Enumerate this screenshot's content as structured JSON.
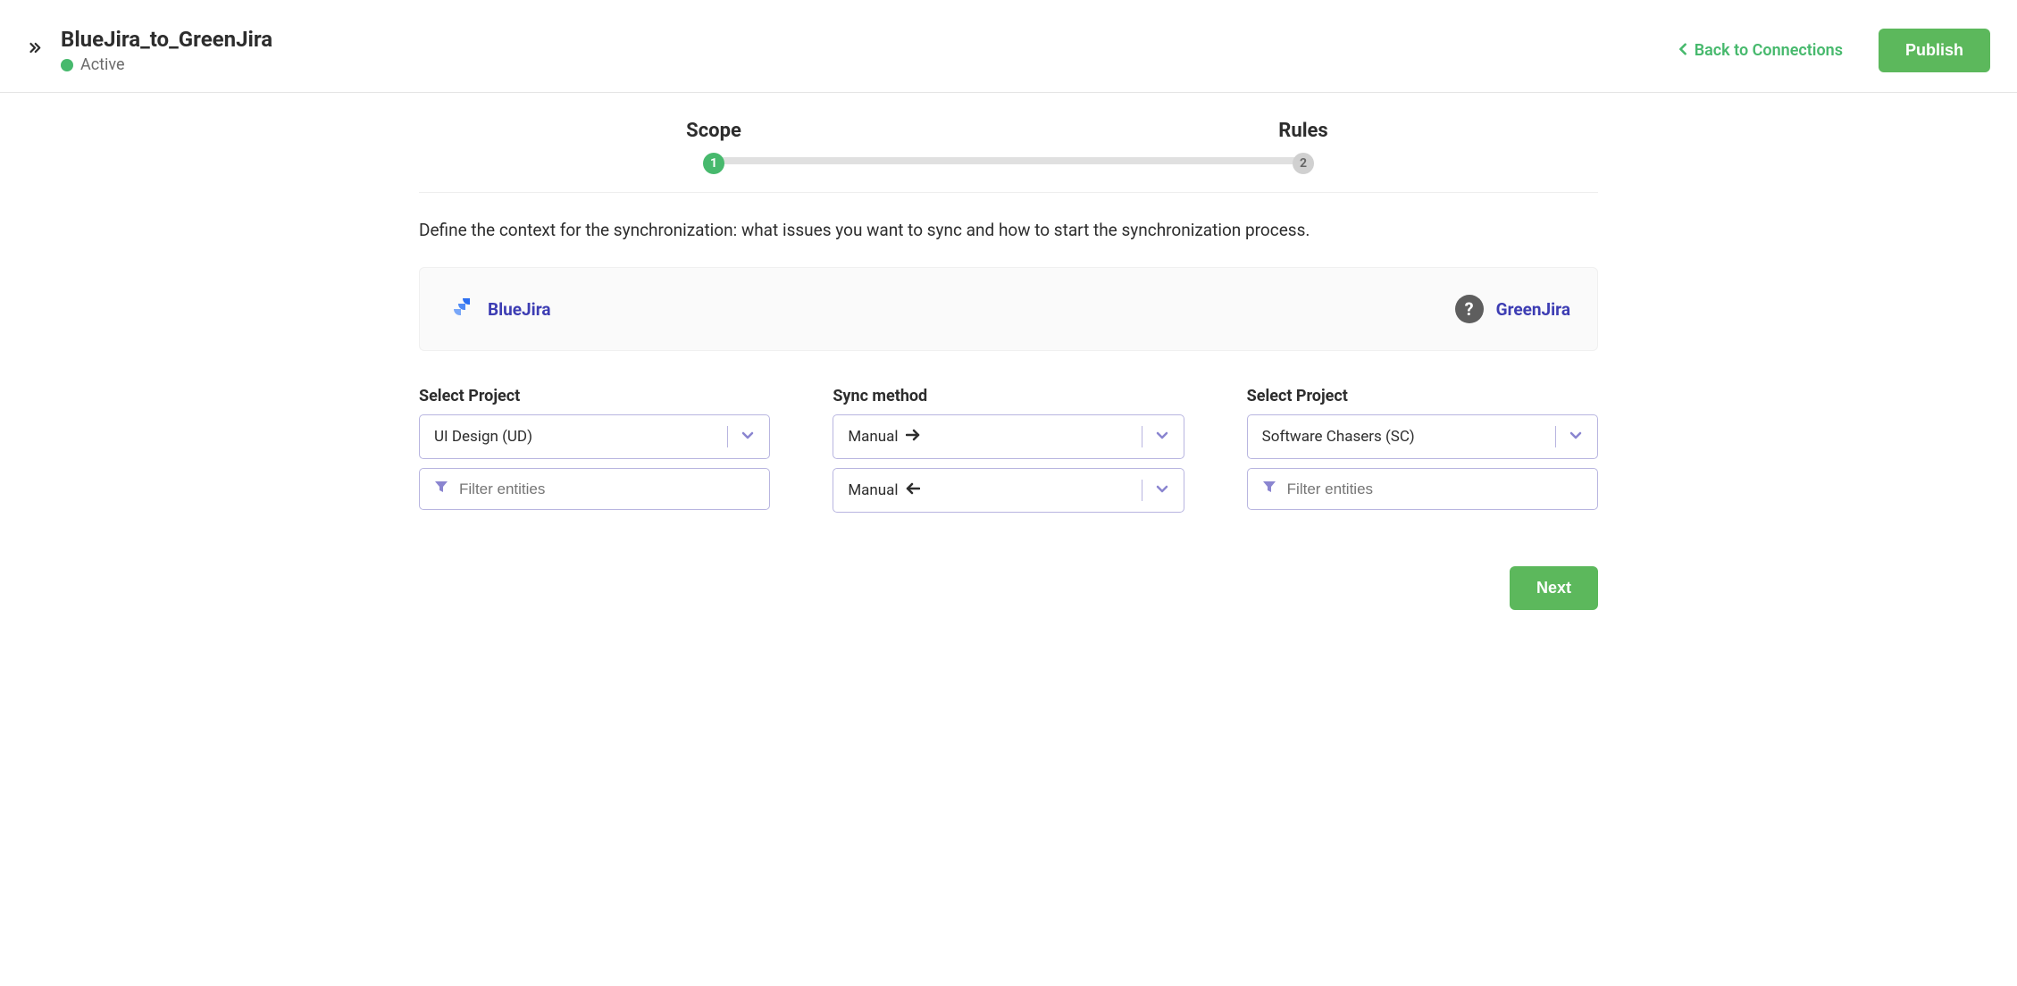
{
  "header": {
    "title": "BlueJira_to_GreenJira",
    "status": "Active",
    "back_link": "Back to Connections",
    "publish_label": "Publish"
  },
  "stepper": {
    "steps": [
      {
        "label": "Scope",
        "number": "1"
      },
      {
        "label": "Rules",
        "number": "2"
      }
    ]
  },
  "description": "Define the context for the synchronization: what issues you want to sync and how to start the synchronization process.",
  "instances": {
    "left": {
      "name": "BlueJira"
    },
    "right": {
      "name": "GreenJira"
    }
  },
  "form": {
    "left": {
      "label": "Select Project",
      "value": "UI Design (UD)",
      "filter_placeholder": "Filter entities"
    },
    "middle": {
      "label": "Sync method",
      "out_value": "Manual",
      "in_value": "Manual"
    },
    "right": {
      "label": "Select Project",
      "value": "Software Chasers (SC)",
      "filter_placeholder": "Filter entities"
    }
  },
  "footer": {
    "next_label": "Next"
  }
}
